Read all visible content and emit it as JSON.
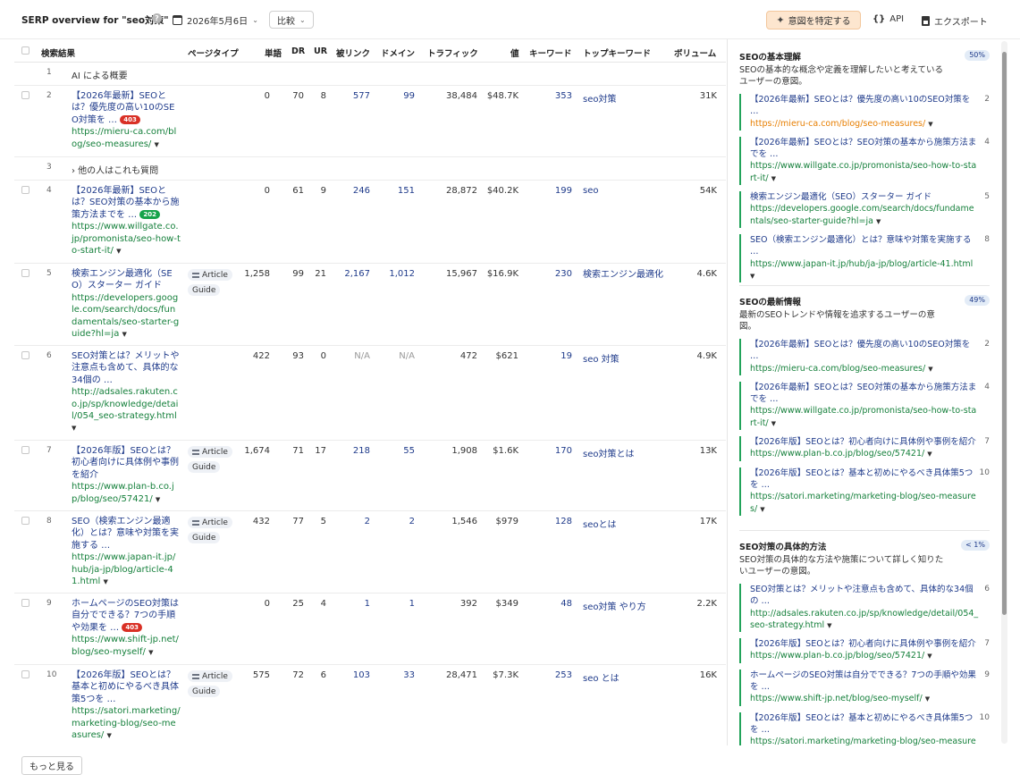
{
  "header": {
    "title": "SERP overview for \"seo対策\"",
    "date": "2026年5月6日",
    "compare_label": "比較",
    "intent_button": "意図を特定する",
    "api_label": "API",
    "export_label": "エクスポート"
  },
  "table": {
    "columns": [
      "検索結果",
      "ページタイプ",
      "単語",
      "DR",
      "UR",
      "被リンク",
      "ドメイン",
      "トラフィック",
      "値",
      "キーワード",
      "トップキーワード",
      "ボリューム"
    ],
    "rows": [
      {
        "rank": "1",
        "special": "AI による概要"
      },
      {
        "rank": "2",
        "title": "【2026年最新】SEOとは？優先度の高い10のSEO対策を …",
        "badge": "403",
        "url": "https://mieru-ca.com/blog/seo-measures/",
        "words": "0",
        "dr": "70",
        "ur": "8",
        "backlinks": "577",
        "domains": "99",
        "traffic": "38,484",
        "value": "$48.7K",
        "keywords": "353",
        "top_keyword": "seo対策",
        "volume": "31K"
      },
      {
        "rank": "3",
        "special": "› 他の人はこれも質問"
      },
      {
        "rank": "4",
        "title": "【2026年最新】SEOとは？SEO対策の基本から施策方法までを …",
        "badge": "202",
        "url": "https://www.willgate.co.jp/promonista/seo-how-to-start-it/",
        "words": "0",
        "dr": "61",
        "ur": "9",
        "backlinks": "246",
        "domains": "151",
        "traffic": "28,872",
        "value": "$40.2K",
        "keywords": "199",
        "top_keyword": "seo",
        "volume": "54K"
      },
      {
        "rank": "5",
        "title": "検索エンジン最適化（SEO）スターター ガイド",
        "url": "https://developers.google.com/search/docs/fundamentals/seo-starter-guide?hl=ja",
        "type1": "Article",
        "type2": "Guide",
        "words": "1,258",
        "dr": "99",
        "ur": "21",
        "backlinks": "2,167",
        "domains": "1,012",
        "traffic": "15,967",
        "value": "$16.9K",
        "keywords": "230",
        "top_keyword": "検索エンジン最適化",
        "volume": "4.6K"
      },
      {
        "rank": "6",
        "title": "SEO対策とは？メリットや注意点も含めて、具体的な34個の …",
        "url": "http://adsales.rakuten.co.jp/sp/knowledge/detail/054_seo-strategy.html",
        "words": "422",
        "dr": "93",
        "ur": "0",
        "backlinks": "N/A",
        "domains": "N/A",
        "traffic": "472",
        "value": "$621",
        "keywords": "19",
        "top_keyword": "seo 対策",
        "volume": "4.9K"
      },
      {
        "rank": "7",
        "title": "【2026年版】SEOとは？初心者向けに具体例や事例を紹介",
        "url": "https://www.plan-b.co.jp/blog/seo/57421/",
        "type1": "Article",
        "type2": "Guide",
        "words": "1,674",
        "dr": "71",
        "ur": "17",
        "backlinks": "218",
        "domains": "55",
        "traffic": "1,908",
        "value": "$1.6K",
        "keywords": "170",
        "top_keyword": "seo対策とは",
        "volume": "13K"
      },
      {
        "rank": "8",
        "title": "SEO（検索エンジン最適化）とは？意味や対策を実施する …",
        "url": "https://www.japan-it.jp/hub/ja-jp/blog/article-41.html",
        "type1": "Article",
        "type2": "Guide",
        "words": "432",
        "dr": "77",
        "ur": "5",
        "backlinks": "2",
        "domains": "2",
        "traffic": "1,546",
        "value": "$979",
        "keywords": "128",
        "top_keyword": "seoとは",
        "volume": "17K"
      },
      {
        "rank": "9",
        "title": "ホームページのSEO対策は自分でできる？7つの手順や効果を …",
        "badge": "403",
        "url": "https://www.shift-jp.net/blog/seo-myself/",
        "words": "0",
        "dr": "25",
        "ur": "4",
        "backlinks": "1",
        "domains": "1",
        "traffic": "392",
        "value": "$349",
        "keywords": "48",
        "top_keyword": "seo対策 やり方",
        "volume": "2.2K"
      },
      {
        "rank": "10",
        "title": "【2026年版】SEOとは？基本と初めにやるべき具体策5つを …",
        "url": "https://satori.marketing/marketing-blog/seo-measures/",
        "type1": "Article",
        "type2": "Guide",
        "words": "575",
        "dr": "72",
        "ur": "6",
        "backlinks": "103",
        "domains": "33",
        "traffic": "28,471",
        "value": "$7.3K",
        "keywords": "253",
        "top_keyword": "seo とは",
        "volume": "16K"
      }
    ],
    "more_label": "もっと見る"
  },
  "intents": [
    {
      "title": "SEOの基本理解",
      "pct": "50%",
      "desc": "SEOの基本的な概念や定義を理解したいと考えているユーザーの意図。",
      "links": [
        {
          "title": "【2026年最新】SEOとは？優先度の高い10のSEO対策を …",
          "url": "https://mieru-ca.com/blog/seo-measures/",
          "rank": "2",
          "orange": true
        },
        {
          "title": "【2026年最新】SEOとは？SEO対策の基本から施策方法までを …",
          "url": "https://www.willgate.co.jp/promonista/seo-how-to-start-it/",
          "rank": "4"
        },
        {
          "title": "検索エンジン最適化（SEO）スターター ガイド",
          "url": "https://developers.google.com/search/docs/fundamentals/seo-starter-guide?hl=ja",
          "rank": "5"
        },
        {
          "title": "SEO（検索エンジン最適化）とは？意味や対策を実施する …",
          "url": "https://www.japan-it.jp/hub/ja-jp/blog/article-41.html",
          "rank": "8"
        }
      ]
    },
    {
      "title": "SEOの最新情報",
      "pct": "49%",
      "desc": "最新のSEOトレンドや情報を追求するユーザーの意図。",
      "links": [
        {
          "title": "【2026年最新】SEOとは？優先度の高い10のSEO対策を …",
          "url": "https://mieru-ca.com/blog/seo-measures/",
          "rank": "2"
        },
        {
          "title": "【2026年最新】SEOとは？SEO対策の基本から施策方法までを …",
          "url": "https://www.willgate.co.jp/promonista/seo-how-to-start-it/",
          "rank": "4"
        },
        {
          "title": "【2026年版】SEOとは？初心者向けに具体例や事例を紹介",
          "url": "https://www.plan-b.co.jp/blog/seo/57421/",
          "rank": "7"
        },
        {
          "title": "【2026年版】SEOとは？基本と初めにやるべき具体策5つを …",
          "url": "https://satori.marketing/marketing-blog/seo-measures/",
          "rank": "10"
        }
      ]
    },
    {
      "title": "SEO対策の具体的方法",
      "pct": "< 1%",
      "desc": "SEO対策の具体的な方法や施策について詳しく知りたいユーザーの意図。",
      "links": [
        {
          "title": "SEO対策とは？メリットや注意点も含めて、具体的な34個の …",
          "url": "http://adsales.rakuten.co.jp/sp/knowledge/detail/054_seo-strategy.html",
          "rank": "6"
        },
        {
          "title": "【2026年版】SEOとは？初心者向けに具体例や事例を紹介",
          "url": "https://www.plan-b.co.jp/blog/seo/57421/",
          "rank": "7"
        },
        {
          "title": "ホームページのSEO対策は自分でできる？7つの手順や効果を …",
          "url": "https://www.shift-jp.net/blog/seo-myself/",
          "rank": "9"
        },
        {
          "title": "【2026年版】SEOとは？基本と初めにやるべき具体策5つを …",
          "url": "https://satori.marketing/marketing-blog/seo-measures/",
          "rank": "10"
        }
      ]
    }
  ]
}
